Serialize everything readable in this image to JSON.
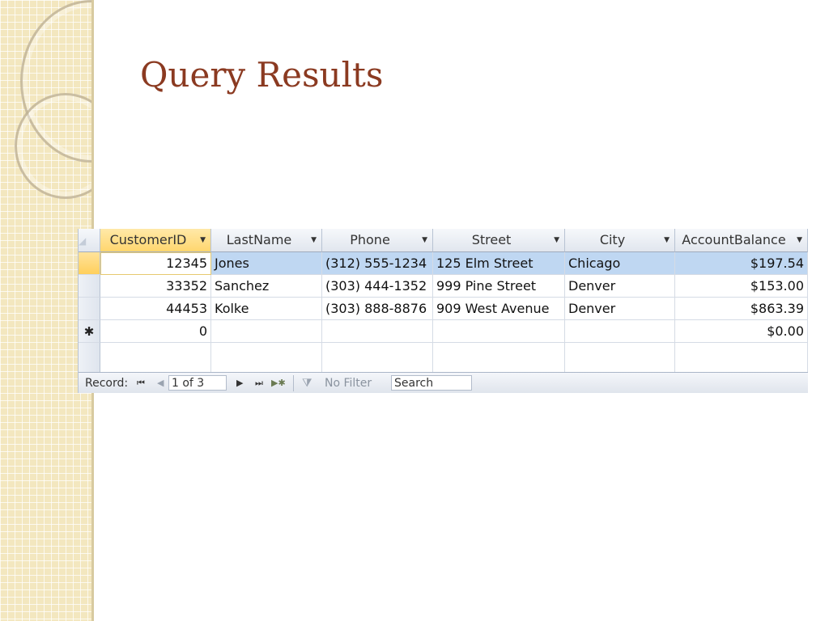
{
  "slide": {
    "title": "Query Results"
  },
  "table": {
    "columns": [
      {
        "key": "id",
        "label": "CustomerID"
      },
      {
        "key": "last",
        "label": "LastName"
      },
      {
        "key": "phone",
        "label": "Phone"
      },
      {
        "key": "street",
        "label": "Street"
      },
      {
        "key": "city",
        "label": "City"
      },
      {
        "key": "bal",
        "label": "AccountBalance"
      }
    ],
    "rows": [
      {
        "id": "12345",
        "last": "Jones",
        "phone": "(312) 555-1234",
        "street": "125 Elm Street",
        "city": "Chicago",
        "bal": "$197.54"
      },
      {
        "id": "33352",
        "last": "Sanchez",
        "phone": "(303) 444-1352",
        "street": "999 Pine Street",
        "city": "Denver",
        "bal": "$153.00"
      },
      {
        "id": "44453",
        "last": "Kolke",
        "phone": "(303) 888-8876",
        "street": "909 West Avenue",
        "city": "Denver",
        "bal": "$863.39"
      }
    ],
    "new_row": {
      "marker": "✱",
      "id": "0",
      "bal": "$0.00"
    }
  },
  "navigation": {
    "label": "Record:",
    "first": "⏮",
    "prev": "◀",
    "position": "1 of 3",
    "next": "▶",
    "last": "⏭",
    "new": "▶✱",
    "filter_icon": "filter-icon",
    "filter_label": "No Filter",
    "search_placeholder": "Search"
  }
}
